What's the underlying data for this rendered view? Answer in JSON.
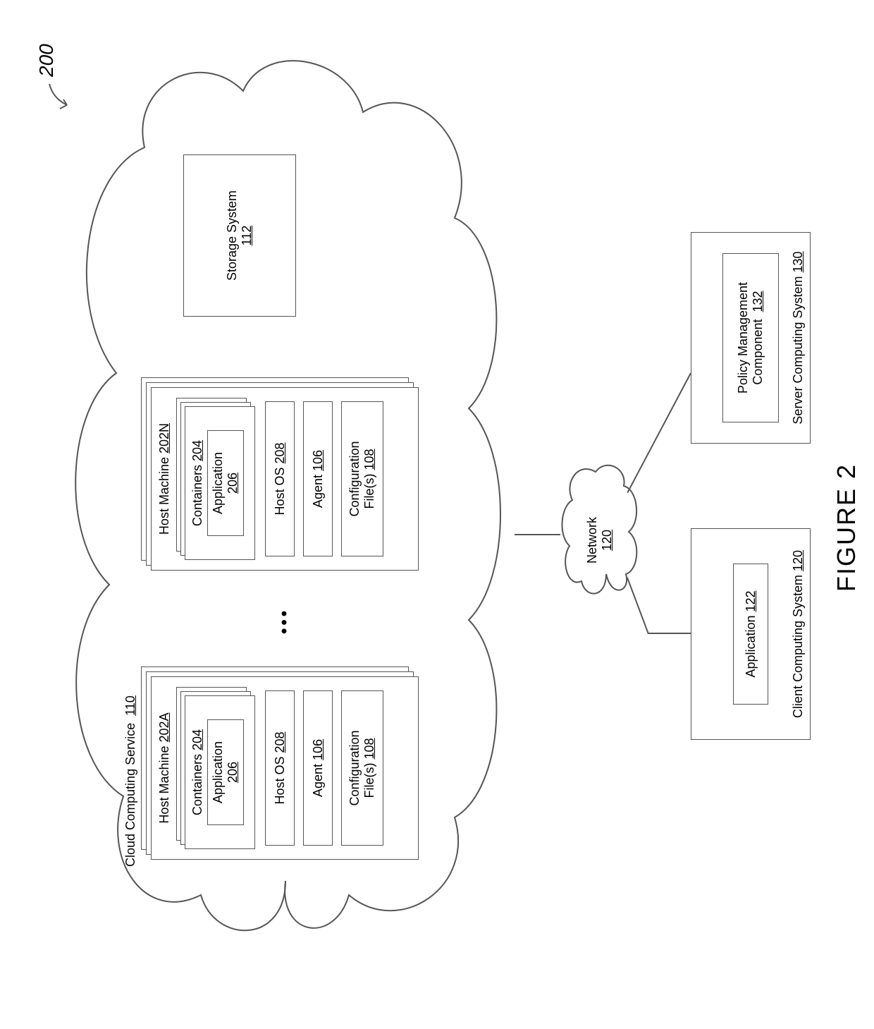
{
  "figure": {
    "label": "FIGURE 2",
    "ref": "200"
  },
  "cloud_service": {
    "label": "Cloud Computing Service",
    "num": "110"
  },
  "host_a": {
    "label": "Host Machine",
    "num": "202A"
  },
  "host_n": {
    "label": "Host Machine",
    "num": "202N"
  },
  "containers": {
    "label": "Containers",
    "num": "204"
  },
  "application": {
    "label": "Application",
    "num": "206"
  },
  "host_os": {
    "label": "Host OS",
    "num": "208"
  },
  "agent": {
    "label": "Agent",
    "num": "106"
  },
  "config": {
    "label": "Configuration\nFile(s)",
    "num": "108"
  },
  "storage": {
    "label": "Storage System",
    "num": "112"
  },
  "network": {
    "label": "Network",
    "num": "120"
  },
  "client": {
    "label": "Client Computing System",
    "num": "120",
    "app_label": "Application",
    "app_num": "122"
  },
  "server": {
    "label": "Server Computing System",
    "num": "130",
    "pmc_label": "Policy Management\nComponent",
    "pmc_num": "132"
  }
}
